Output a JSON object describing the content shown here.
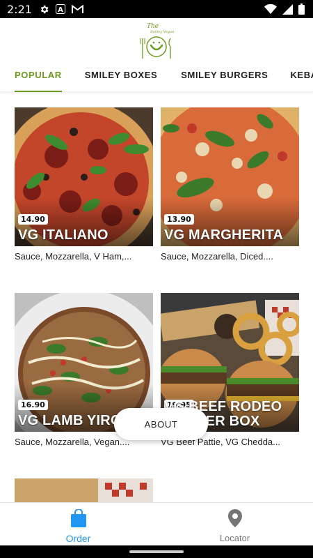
{
  "status_bar": {
    "time": "2:21",
    "icons_left": [
      "gear-icon",
      "a-badge-icon",
      "gmail-icon"
    ],
    "icons_right": [
      "wifi-icon",
      "signal-icon",
      "battery-icon"
    ]
  },
  "header": {
    "logo_text_line1": "The",
    "logo_text_line2": "Smiley Vegan",
    "brand_color": "#6b9a1e"
  },
  "tabs": [
    {
      "label": "POPULAR",
      "active": true
    },
    {
      "label": "SMILEY BOXES",
      "active": false
    },
    {
      "label": "SMILEY BURGERS",
      "active": false
    },
    {
      "label": "KEBAB (Y",
      "active": false
    }
  ],
  "products": [
    {
      "price": "14.90",
      "name": "VG ITALIANO",
      "description": "Sauce, Mozzarella, V Ham,..."
    },
    {
      "price": "13.90",
      "name": "VG MARGHERITA",
      "description": "Sauce, Mozzarella, Diced...."
    },
    {
      "price": "16.90",
      "name": "VG LAMB YIRO",
      "description": "Sauce, Mozzarella, Vegan...."
    },
    {
      "price": "19.95",
      "name": "VG BEEF RODEO BURGER BOX",
      "description": "VG Beef Pattie, VG Chedda..."
    }
  ],
  "about_button": {
    "label": "ABOUT"
  },
  "bottom_nav": [
    {
      "label": "Order",
      "icon": "shopping-bag-icon",
      "active": true
    },
    {
      "label": "Locator",
      "icon": "location-pin-icon",
      "active": false
    }
  ],
  "colors": {
    "accent": "#2196f3",
    "brand": "#6b9a1e"
  }
}
